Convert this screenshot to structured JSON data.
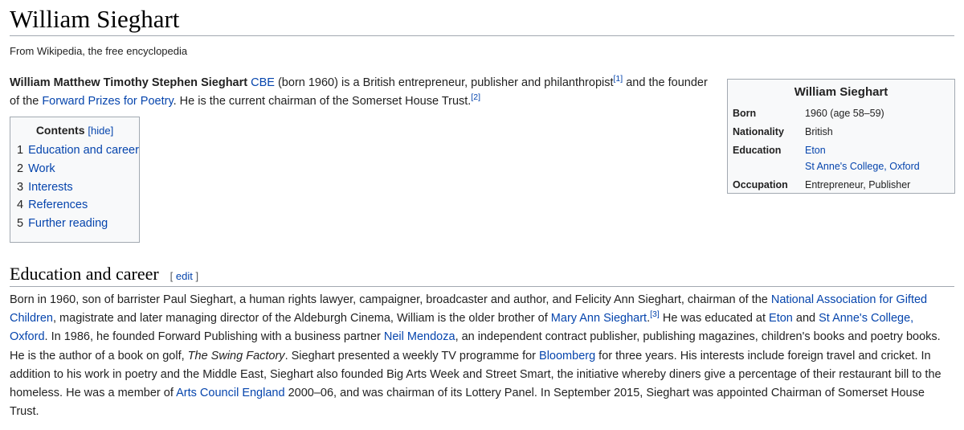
{
  "article": {
    "title": "William Sieghart",
    "tagline": "From Wikipedia, the free encyclopedia"
  },
  "lead": {
    "name": "William Matthew Timothy Stephen Sieghart",
    "cbe": "CBE",
    "t1": " (born 1960) is a British entrepreneur, publisher and philanthropist",
    "ref1": "[1]",
    "t2": " and the founder of the ",
    "forward_prizes": "Forward Prizes for Poetry",
    "t3": ". He is the current chairman of the Somerset House Trust.",
    "ref2": "[2]"
  },
  "toc": {
    "title": "Contents",
    "hide": "[hide]",
    "items": [
      {
        "num": "1",
        "label": "Education and career"
      },
      {
        "num": "2",
        "label": "Work"
      },
      {
        "num": "3",
        "label": "Interests"
      },
      {
        "num": "4",
        "label": "References"
      },
      {
        "num": "5",
        "label": "Further reading"
      }
    ]
  },
  "infobox": {
    "title": "William Sieghart",
    "born_label": "Born",
    "born_value": "1960 (age 58–59)",
    "nationality_label": "Nationality",
    "nationality_value": "British",
    "education_label": "Education",
    "education_value1": "Eton",
    "education_value2": "St Anne's College, Oxford",
    "occupation_label": "Occupation",
    "occupation_value": "Entrepreneur, Publisher"
  },
  "section": {
    "heading": "Education and career",
    "edit_open": "[ ",
    "edit": "edit",
    "edit_close": " ]",
    "p1": "Born in 1960, son of barrister Paul Sieghart, a human rights lawyer, campaigner, broadcaster and author, and Felicity Ann Sieghart, chairman of the ",
    "nagc": "National Association for Gifted Children",
    "p2": ", magistrate and later managing director of the Aldeburgh Cinema, William is the older brother of ",
    "mary_ann": "Mary Ann Sieghart",
    "p2b": ".",
    "ref3": "[3]",
    "p3": " He was educated at ",
    "eton": "Eton",
    "p4": " and ",
    "st_annes": "St Anne's College, Oxford",
    "p5": ". In 1986, he founded Forward Publishing with a business partner ",
    "mendoza": "Neil Mendoza",
    "p6": ", an independent contract publisher, publishing magazines, children's books and poetry books. He is the author of a book on golf, ",
    "swing": "The Swing Factory",
    "p7": ". Sieghart presented a weekly TV programme for ",
    "bloomberg": "Bloomberg",
    "p8": " for three years. His interests include foreign travel and cricket. In addition to his work in poetry and the Middle East, Sieghart also founded Big Arts Week and Street Smart, the initiative whereby diners give a percentage of their restaurant bill to the homeless. He was a member of ",
    "ace": "Arts Council England",
    "p9": " 2000–06, and was chairman of its Lottery Panel. In September 2015, Sieghart was appointed Chairman of Somerset House Trust."
  }
}
